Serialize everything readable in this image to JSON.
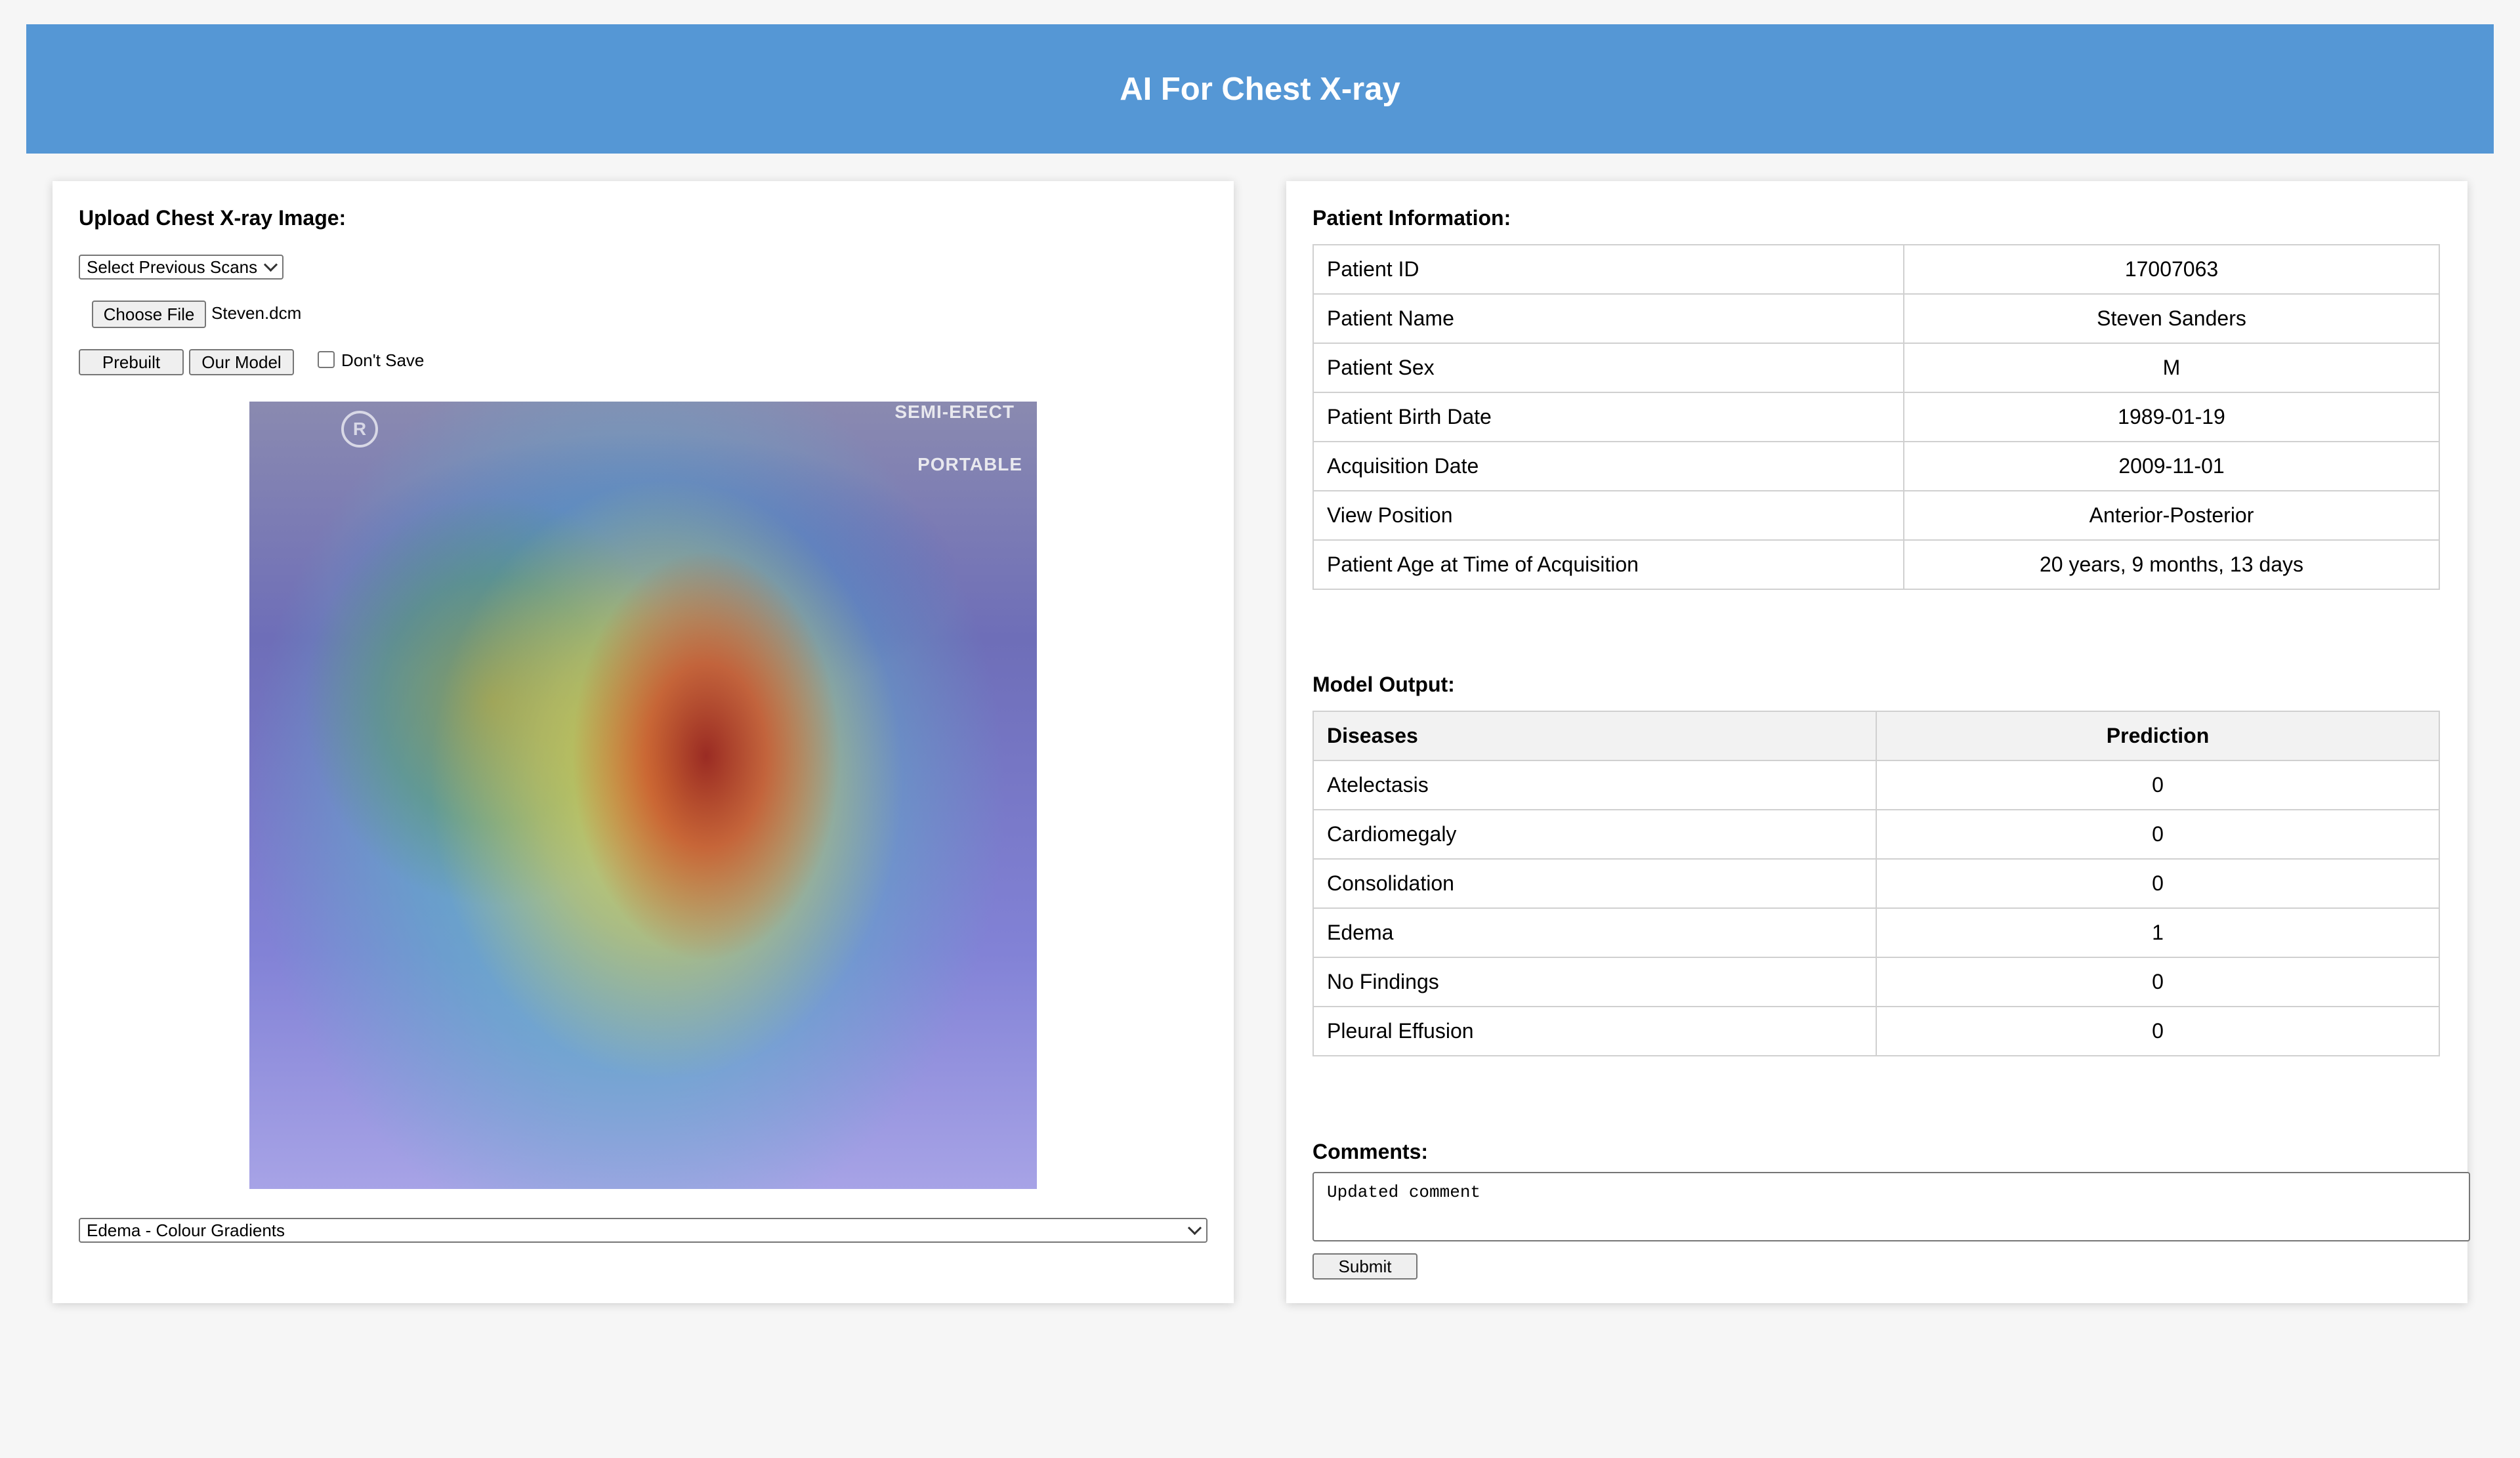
{
  "app": {
    "title": "AI For Chest X-ray"
  },
  "upload": {
    "label": "Upload Chest X-ray Image:",
    "previous_scans": "Select Previous Scans",
    "choose_file": "Choose File",
    "file_name": "Steven.dcm",
    "prebuilt_button": "Prebuilt",
    "our_model_button": "Our Model",
    "dont_save_label": "Don't Save",
    "dont_save_checked": false,
    "image_overlay_text": [
      "SEMI-ERECT",
      "PORTABLE"
    ],
    "image_marker": "R",
    "heatmap_select": "Edema - Colour Gradients"
  },
  "patient": {
    "label": "Patient Information:",
    "rows": [
      {
        "field": "Patient ID",
        "value": "17007063"
      },
      {
        "field": "Patient Name",
        "value": "Steven Sanders"
      },
      {
        "field": "Patient Sex",
        "value": "M"
      },
      {
        "field": "Patient Birth Date",
        "value": "1989-01-19"
      },
      {
        "field": "Acquisition Date",
        "value": "2009-11-01"
      },
      {
        "field": "View Position",
        "value": "Anterior-Posterior"
      },
      {
        "field": "Patient Age at Time of Acquisition",
        "value": "20 years, 9 months, 13 days"
      }
    ]
  },
  "model_output": {
    "label": "Model Output:",
    "columns": [
      "Diseases",
      "Prediction"
    ],
    "rows": [
      {
        "disease": "Atelectasis",
        "prediction": "0"
      },
      {
        "disease": "Cardiomegaly",
        "prediction": "0"
      },
      {
        "disease": "Consolidation",
        "prediction": "0"
      },
      {
        "disease": "Edema",
        "prediction": "1"
      },
      {
        "disease": "No Findings",
        "prediction": "0"
      },
      {
        "disease": "Pleural Effusion",
        "prediction": "0"
      }
    ]
  },
  "comments": {
    "label": "Comments:",
    "value": "Updated comment",
    "submit": "Submit"
  },
  "colors": {
    "header": "#5597d5",
    "page_bg": "#f6f6f6",
    "panel_bg": "#ffffff"
  }
}
